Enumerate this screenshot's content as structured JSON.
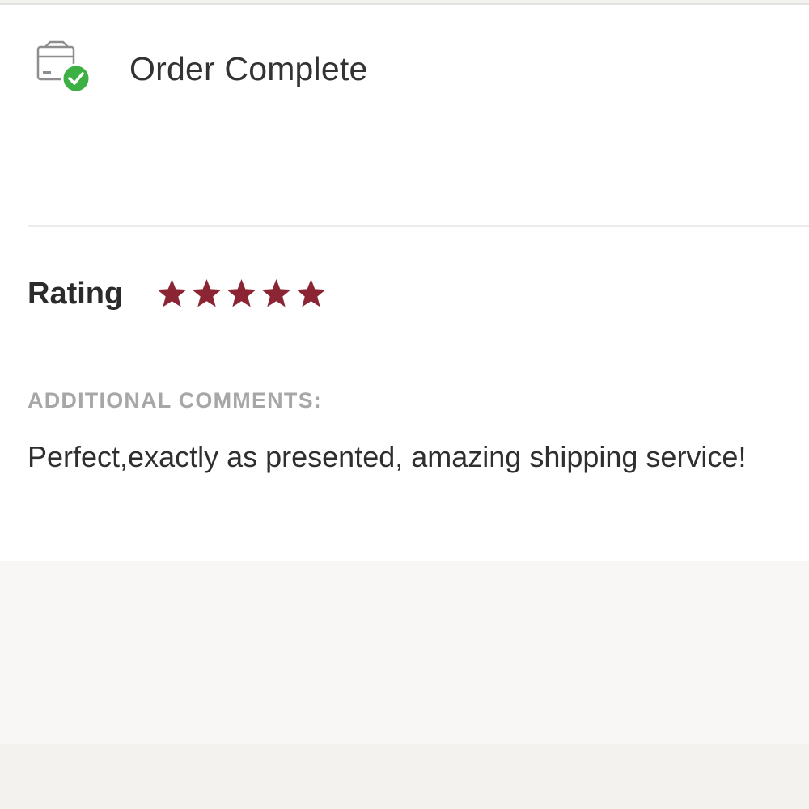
{
  "order": {
    "status_title": "Order Complete",
    "icon": "package-check-icon",
    "check_color": "#3cb043"
  },
  "rating": {
    "label": "Rating",
    "value": 5,
    "max": 5,
    "star_color": "#8b2533"
  },
  "comments": {
    "label": "ADDITIONAL COMMENTS:",
    "text": "Perfect,exactly as presented, amazing shipping service!"
  }
}
